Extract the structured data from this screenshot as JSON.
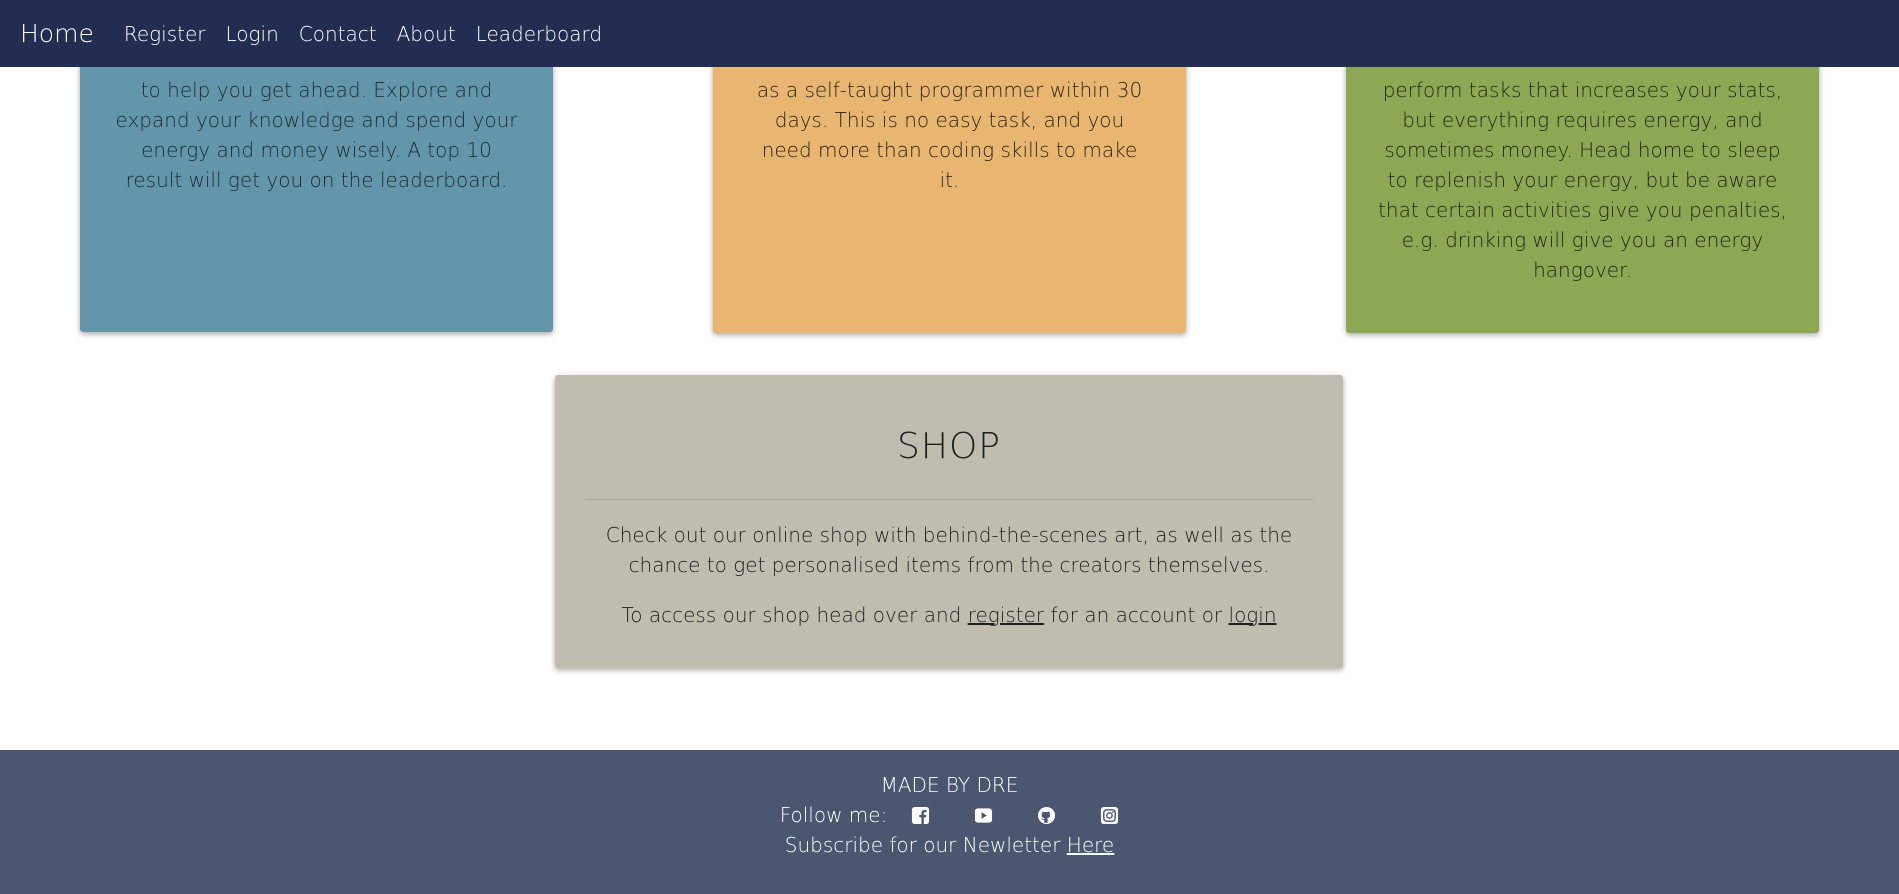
{
  "nav": {
    "brand": "Home",
    "links": [
      "Register",
      "Login",
      "Contact",
      "About",
      "Leaderboard"
    ]
  },
  "cards": {
    "blue": {
      "text": "to help you get ahead. Explore and expand your knowledge and spend your energy and money wisely. A top 10 result will get you on the leaderboard."
    },
    "orange": {
      "text": "as a self-taught programmer within 30 days. This is no easy task, and you need more than coding skills to make it."
    },
    "green": {
      "text": "perform tasks that increases your stats, but everything requires energy, and sometimes money. Head home to sleep to replenish your energy, but be aware that certain activities give you penalties, e.g. drinking will give you an energy hangover."
    }
  },
  "shop": {
    "title": "SHOP",
    "description": "Check out our online shop with behind-the-scenes art, as well as the chance to get personalised items from the creators themselves.",
    "access_prefix": "To access our shop head over and",
    "register_link": "register",
    "access_middle": "for an account or",
    "login_link": "login"
  },
  "footer": {
    "made_by": "MADE BY DRE",
    "follow_label": "Follow me:",
    "icons": [
      "facebook-icon",
      "youtube-icon",
      "github-icon",
      "instagram-icon"
    ],
    "subscribe_text": "Subscribe for our Newletter",
    "subscribe_link": "Here"
  },
  "colors": {
    "navbar": "#222d51",
    "card_blue": "#6496ab",
    "card_orange": "#e8b671",
    "card_green": "#8ea755",
    "shop": "#c1bcb0",
    "footer": "#4b5770"
  }
}
